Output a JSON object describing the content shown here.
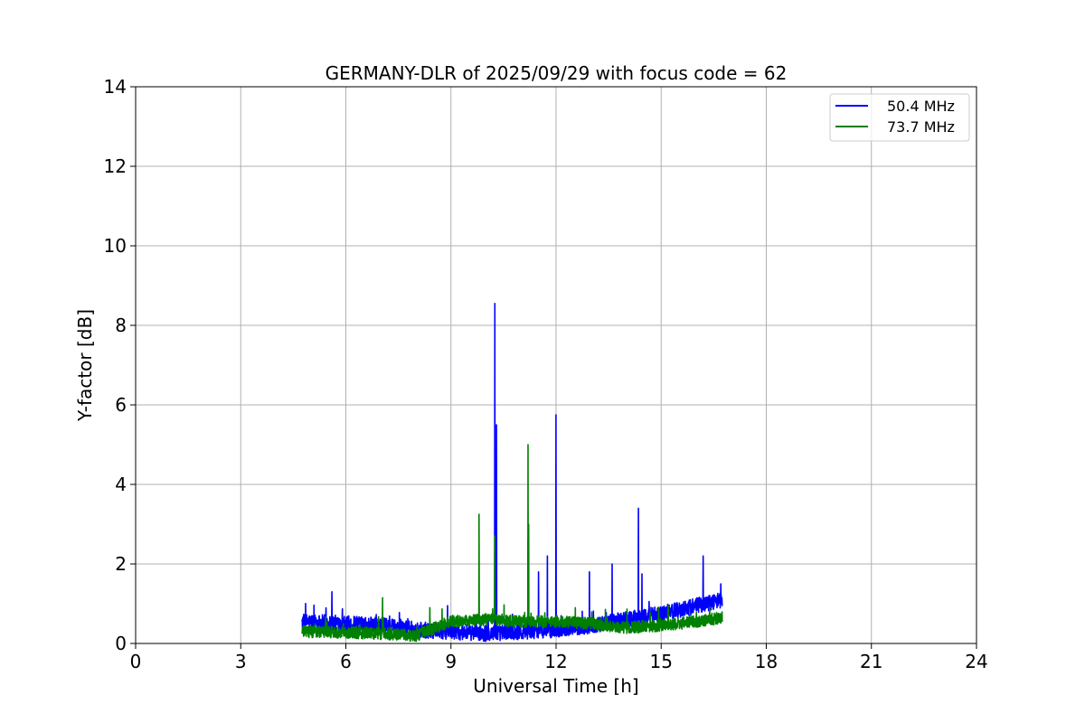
{
  "chart_data": {
    "type": "line",
    "title": "GERMANY-DLR of 2025/09/29 with focus code = 62",
    "xlabel": "Universal Time [h]",
    "ylabel": "Y-factor [dB]",
    "xlim": [
      0,
      24
    ],
    "ylim": [
      0,
      14
    ],
    "xticks": [
      0,
      3,
      6,
      9,
      12,
      15,
      18,
      21,
      24
    ],
    "yticks": [
      0,
      2,
      4,
      6,
      8,
      10,
      12,
      14
    ],
    "grid": true,
    "legend_position": "top-right",
    "series": [
      {
        "name": "50.4 MHz",
        "color": "#0000ff",
        "x_range": [
          4.75,
          16.75
        ],
        "baseline": [
          [
            4.75,
            0.55
          ],
          [
            6.0,
            0.5
          ],
          [
            7.0,
            0.45
          ],
          [
            8.0,
            0.35
          ],
          [
            9.0,
            0.3
          ],
          [
            10.0,
            0.25
          ],
          [
            11.0,
            0.3
          ],
          [
            12.0,
            0.35
          ],
          [
            13.0,
            0.45
          ],
          [
            14.0,
            0.6
          ],
          [
            15.0,
            0.75
          ],
          [
            16.0,
            0.95
          ],
          [
            16.75,
            1.1
          ]
        ],
        "noise_amplitude": 0.2,
        "spikes": [
          [
            5.6,
            1.3
          ],
          [
            8.9,
            0.95
          ],
          [
            10.25,
            8.55
          ],
          [
            10.3,
            5.5
          ],
          [
            11.2,
            2.6
          ],
          [
            11.5,
            1.8
          ],
          [
            11.75,
            2.2
          ],
          [
            12.0,
            5.75
          ],
          [
            12.95,
            1.8
          ],
          [
            13.6,
            2.0
          ],
          [
            14.35,
            3.4
          ],
          [
            14.45,
            1.75
          ],
          [
            16.2,
            2.2
          ],
          [
            16.7,
            1.5
          ]
        ]
      },
      {
        "name": "73.7 MHz",
        "color": "#008000",
        "x_range": [
          4.75,
          16.75
        ],
        "baseline": [
          [
            4.75,
            0.3
          ],
          [
            6.0,
            0.28
          ],
          [
            7.0,
            0.25
          ],
          [
            8.0,
            0.2
          ],
          [
            9.0,
            0.55
          ],
          [
            10.0,
            0.6
          ],
          [
            11.0,
            0.55
          ],
          [
            12.0,
            0.55
          ],
          [
            13.0,
            0.5
          ],
          [
            14.0,
            0.4
          ],
          [
            15.0,
            0.45
          ],
          [
            16.0,
            0.55
          ],
          [
            16.75,
            0.65
          ]
        ],
        "noise_amplitude": 0.15,
        "spikes": [
          [
            7.05,
            1.15
          ],
          [
            8.4,
            0.9
          ],
          [
            9.8,
            3.25
          ],
          [
            10.25,
            2.7
          ],
          [
            11.2,
            5.0
          ],
          [
            11.22,
            3.0
          ],
          [
            12.55,
            0.9
          ],
          [
            15.2,
            0.95
          ]
        ]
      }
    ]
  }
}
